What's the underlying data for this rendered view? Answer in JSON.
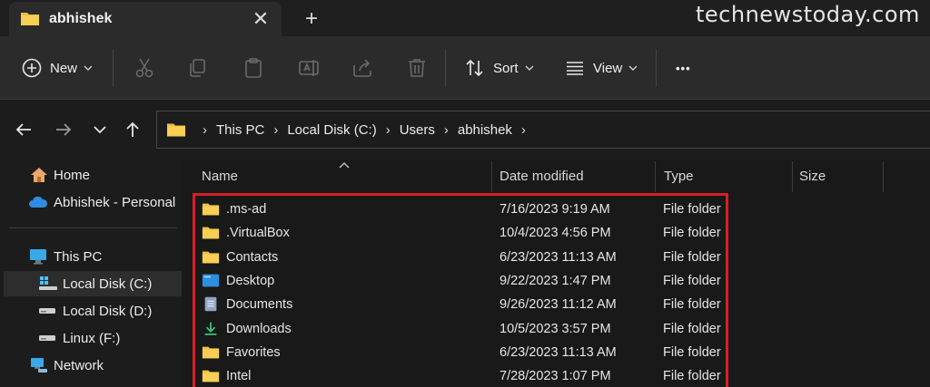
{
  "tab": {
    "title": "abhishek",
    "close_symbol": "✕",
    "new_tab_symbol": "+"
  },
  "watermark": "technewstoday.com",
  "toolbar": {
    "new_label": "New",
    "sort_label": "Sort",
    "view_label": "View",
    "more_symbol": "•••"
  },
  "address": {
    "crumbs": [
      "This PC",
      "Local Disk (C:)",
      "Users",
      "abhishek"
    ],
    "separator": "›"
  },
  "sidebar": {
    "items": [
      {
        "label": "Home",
        "icon": "home-icon"
      },
      {
        "label": "Abhishek - Personal",
        "icon": "cloud-icon"
      },
      {
        "label": "This PC",
        "icon": "computer-icon"
      },
      {
        "label": "Local Disk (C:)",
        "icon": "drive-icon",
        "selected": true
      },
      {
        "label": "Local Disk (D:)",
        "icon": "drive-icon"
      },
      {
        "label": "Linux (F:)",
        "icon": "drive-icon"
      },
      {
        "label": "Network",
        "icon": "network-icon"
      }
    ]
  },
  "columns": {
    "name": "Name",
    "date": "Date modified",
    "type": "Type",
    "size": "Size"
  },
  "files": [
    {
      "name": ".ms-ad",
      "date": "7/16/2023 9:19 AM",
      "type": "File folder",
      "icon": "folder-icon"
    },
    {
      "name": ".VirtualBox",
      "date": "10/4/2023 4:56 PM",
      "type": "File folder",
      "icon": "folder-icon"
    },
    {
      "name": "Contacts",
      "date": "6/23/2023 11:13 AM",
      "type": "File folder",
      "icon": "folder-icon"
    },
    {
      "name": "Desktop",
      "date": "9/22/2023 1:47 PM",
      "type": "File folder",
      "icon": "desktop-icon"
    },
    {
      "name": "Documents",
      "date": "9/26/2023 11:12 AM",
      "type": "File folder",
      "icon": "documents-icon"
    },
    {
      "name": "Downloads",
      "date": "10/5/2023 3:57 PM",
      "type": "File folder",
      "icon": "download-icon"
    },
    {
      "name": "Favorites",
      "date": "6/23/2023 11:13 AM",
      "type": "File folder",
      "icon": "folder-icon"
    },
    {
      "name": "Intel",
      "date": "7/28/2023 1:07 PM",
      "type": "File folder",
      "icon": "folder-icon"
    }
  ],
  "colors": {
    "folder": "#f0c044",
    "highlight": "#d61f26",
    "accent": "#4cc2ff"
  }
}
